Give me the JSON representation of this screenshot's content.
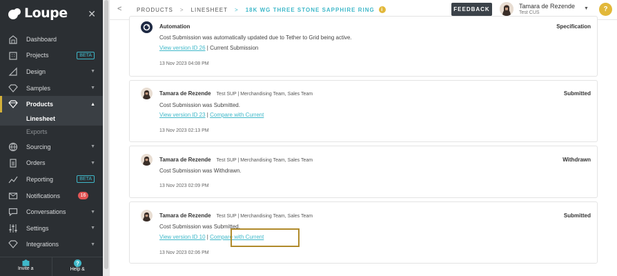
{
  "app": {
    "logo_text": "Loupe"
  },
  "sidebar": {
    "items": [
      {
        "label": "Dashboard",
        "icon": "home-icon"
      },
      {
        "label": "Projects",
        "icon": "building-icon",
        "badge": "BETA"
      },
      {
        "label": "Design",
        "icon": "ruler-icon",
        "caret": "▼"
      },
      {
        "label": "Samples",
        "icon": "gem-icon",
        "caret": "▼"
      },
      {
        "label": "Products",
        "icon": "diamond-icon",
        "caret": "▲",
        "active": true
      },
      {
        "label": "Sourcing",
        "icon": "globe-icon",
        "caret": "▼"
      },
      {
        "label": "Orders",
        "icon": "clipboard-icon",
        "caret": "▼"
      },
      {
        "label": "Reporting",
        "icon": "chart-line-icon",
        "badge": "BETA"
      },
      {
        "label": "Notifications",
        "icon": "envelope-icon",
        "count": "16"
      },
      {
        "label": "Conversations",
        "icon": "chat-icon",
        "caret": "▼"
      },
      {
        "label": "Settings",
        "icon": "sliders-icon",
        "caret": "▼"
      },
      {
        "label": "Integrations",
        "icon": "network-icon",
        "caret": "▼"
      }
    ],
    "sub_items": [
      {
        "label": "Linesheet",
        "active": true
      },
      {
        "label": "Exports"
      }
    ],
    "bottom": {
      "invite_label": "Invite a",
      "help_label": "Help &"
    }
  },
  "topbar": {
    "breadcrumb": [
      "PRODUCTS",
      "LINESHEET",
      "18K WG THREE STONE SAPPHIRE RING"
    ],
    "feedback_label": "FEEDBACK",
    "user_name": "Tamara de Rezende",
    "user_org": "Test CUS",
    "help_label": "?"
  },
  "colors": {
    "accent": "#3fb8c9",
    "sidebar": "#2b2f33",
    "highlight": "#b08a2a",
    "gold": "#e2b83a"
  },
  "cards": [
    {
      "author": "Automation",
      "team": "",
      "status": "Specification",
      "message": "Cost Submission was automatically updated due to Tether to Grid being active.",
      "link1": "View version ID 26",
      "sep": " | ",
      "extra_text": "Current Submission",
      "link2": "",
      "timestamp": "13 Nov 2023 04:08 PM"
    },
    {
      "author": "Tamara de Rezende",
      "team": "Test SUP | Merchandising Team, Sales Team",
      "status": "Submitted",
      "message": "Cost Submission was Submitted.",
      "link1": "View version ID 23",
      "sep": " | ",
      "link2": "Compare with Current",
      "timestamp": "13 Nov 2023 02:13 PM"
    },
    {
      "author": "Tamara de Rezende",
      "team": "Test SUP | Merchandising Team, Sales Team",
      "status": "Withdrawn",
      "message": "Cost Submission was Withdrawn.",
      "timestamp": "13 Nov 2023 02:09 PM"
    },
    {
      "author": "Tamara de Rezende",
      "team": "Test SUP | Merchandising Team, Sales Team",
      "status": "Submitted",
      "message": "Cost Submission was Submitted.",
      "link1": "View version ID 10",
      "sep": " | ",
      "link2": "Compare with Current",
      "timestamp": "13 Nov 2023 02:06 PM"
    }
  ]
}
